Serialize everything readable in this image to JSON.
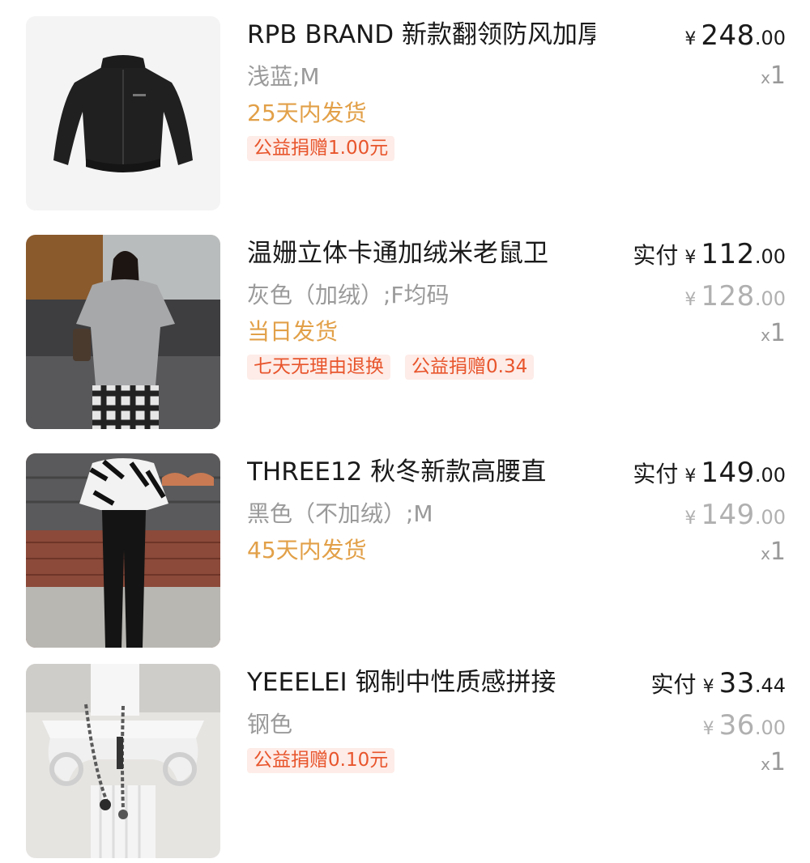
{
  "colors": {
    "title": "#1a1a1a",
    "muted": "#9a9a9a",
    "shipping": "#e2a048",
    "tag_text": "#e8552c",
    "tag_bg": "#fdece8"
  },
  "items": [
    {
      "title": "RPB BRAND 新款翻领防风加厚",
      "variant": "浅蓝;M",
      "shipping": "25天内发货",
      "tags": [
        "公益捐赠1.00元"
      ],
      "paid_label": "",
      "currency": "¥",
      "price_int": "248",
      "price_dec": ".00",
      "orig_int": "",
      "orig_dec": "",
      "qty_prefix": "x",
      "qty": "1",
      "image": "black-puffer-jacket"
    },
    {
      "title": "温姗立体卡通加绒米老鼠卫",
      "variant": "灰色（加绒）;F均码",
      "shipping": "当日发货",
      "tags": [
        "七天无理由退换",
        "公益捐赠0.34"
      ],
      "paid_label": "实付",
      "currency": "¥",
      "price_int": "112",
      "price_dec": ".00",
      "orig_int": "128",
      "orig_dec": ".00",
      "qty_prefix": "x",
      "qty": "1",
      "image": "grey-sweatshirt-model"
    },
    {
      "title": "THREE12 秋冬新款高腰直",
      "variant": "黑色（不加绒）;M",
      "shipping": "45天内发货",
      "tags": [],
      "paid_label": "实付",
      "currency": "¥",
      "price_int": "149",
      "price_dec": ".00",
      "orig_int": "149",
      "orig_dec": ".00",
      "qty_prefix": "x",
      "qty": "1",
      "image": "black-jeans-model"
    },
    {
      "title": "YEEELEI 钢制中性质感拼接",
      "variant": "钢色",
      "shipping": "",
      "tags": [
        "公益捐赠0.10元"
      ],
      "paid_label": "实付",
      "currency": "¥",
      "price_int": "33",
      "price_dec": ".44",
      "orig_int": "36",
      "orig_dec": ".00",
      "qty_prefix": "x",
      "qty": "1",
      "image": "steel-chain-necklace"
    }
  ]
}
